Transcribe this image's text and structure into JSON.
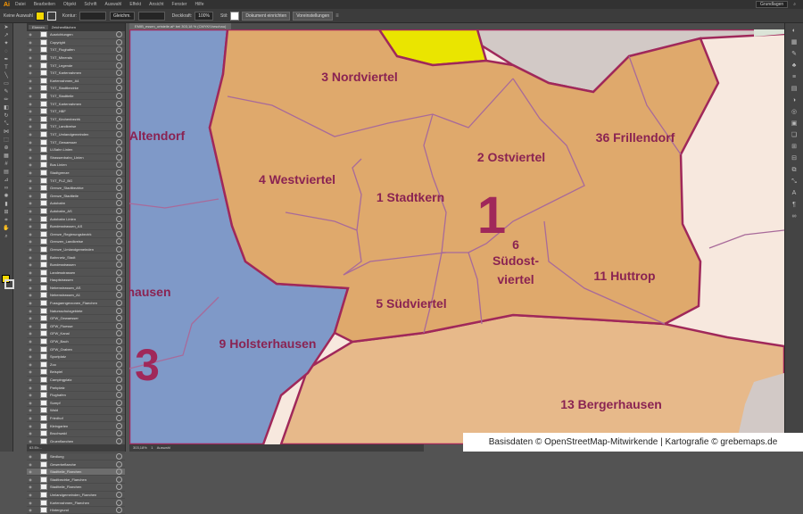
{
  "app": {
    "logo": "Ai"
  },
  "menubar": {
    "items": [
      "Datei",
      "Bearbeiten",
      "Objekt",
      "Schrift",
      "Auswahl",
      "Effekt",
      "Ansicht",
      "Fenster",
      "Hilfe"
    ],
    "workspace": "Grundlagen"
  },
  "controlbar": {
    "selection_label": "Keine Auswahl",
    "stroke_label": "Kontur:",
    "brush_value": "Gleichm.",
    "opacity_label": "Deckkraft:",
    "opacity_value": "100%",
    "style_label": "Stil:",
    "doc_setup_label": "Dokument einrichten",
    "preferences_label": "Voreinstellungen"
  },
  "colors": {
    "fill_swatch": "#f5d800",
    "accent": "#ff9a00"
  },
  "layers_panel": {
    "tabs": [
      "Ebenen",
      "Zeichenflächen"
    ],
    "layers": [
      "Ausrichtungen",
      "Copyright",
      "TXT_Flughafen",
      "TXT_Minerals",
      "TXT_Legende",
      "TXT_Kartenrahmen",
      "Kartenrahmen_A4",
      "TXT_Stadtbezirke",
      "TXT_Stadtteile",
      "TXT_Kartenrahmen",
      "TXT_HBF",
      "TXT_Kirchenbezirk",
      "TXT_Landkreise",
      "TXT_Umlandgemeinden",
      "TXT_Gewaesser",
      "U-Bahn Linien",
      "Strassenbahn_Linien",
      "Bus Linien",
      "Stadtgrenze",
      "TXT_PLZ_BG",
      "Grenze_Stadtbezirke",
      "Grenze_Stadtteile",
      "Autobahn",
      "Autobahn_AS",
      "Autobahn Linien",
      "Bundesstrassen_AS",
      "Grenze_Regierungsbezirk",
      "Grenzen_Landkreise",
      "Grenze_Umlandgemeinden",
      "Bahnnetz_Stadt",
      "Bundesstrassen",
      "Landesstrassen",
      "Hauptstrassen",
      "Nebenstrassen_AS",
      "Nebenstrassen_A1",
      "Fussgaengerzonen_Flaechen",
      "Natursschutzgebiete",
      "GFW_Gewaesser",
      "GFW_Fluesse",
      "GFW_Kanal",
      "GFW_Bach",
      "GFW_Graben",
      "Sportplatz",
      "Zoo",
      "Beispiel",
      "Campingplatz",
      "Parkplatz",
      "Flughafen",
      "Sumpf",
      "Wald",
      "Friedhof",
      "Kleingarten",
      "Bruchwald",
      "Gruenflaechen",
      "Wald_Nord",
      "Siedlung",
      "Gewerbeflaeche",
      "Stadtteile_Flaechen",
      "Stadtbezirke_Flaechen",
      "Stadtteile_Flaechen",
      "Umlandgemeinden_Flaechen",
      "Kartenrahmen_Flaechen",
      "Hintergrund"
    ],
    "selected_index": 57,
    "footer": "63 Eb..."
  },
  "document": {
    "tab_title": "EMIB_essen_ortsteile.ai* bei 303,18 % (CMYK/Vorschau)"
  },
  "statusbar": {
    "zoom": "303,18%",
    "page": "1",
    "info": "Auswahl"
  },
  "map": {
    "district_numbers": [
      {
        "label": "1",
        "color": "#a0285a"
      },
      {
        "label": "3",
        "color": "#a0285a"
      }
    ],
    "areas": [
      {
        "label": "3 Nordviertel"
      },
      {
        "label": "Altendorf"
      },
      {
        "label": "4 Westviertel"
      },
      {
        "label": "1 Stadtkern"
      },
      {
        "label": "2 Ostviertel"
      },
      {
        "label": "36 Frillendorf"
      },
      {
        "label": "6"
      },
      {
        "label": "Südost-"
      },
      {
        "label": "viertel"
      },
      {
        "label": "hausen"
      },
      {
        "label": "5 Südviertel"
      },
      {
        "label": "11 Huttrop"
      },
      {
        "label": "9 Holsterhausen"
      },
      {
        "label": "13 Bergerhausen"
      }
    ],
    "colors": {
      "center": "#dfa96c",
      "west": "#7f99c8",
      "south": "#e7b98a",
      "east": "#f7e8de",
      "grey": "#d2c9c6",
      "green": "#dbe4d7",
      "yellow": "#eae500",
      "border": "#a0285a",
      "label": "#8a2352"
    }
  },
  "credit": {
    "text": "Basisdaten © OpenStreetMap-Mitwirkende | Kartografie © grebemaps.de"
  }
}
